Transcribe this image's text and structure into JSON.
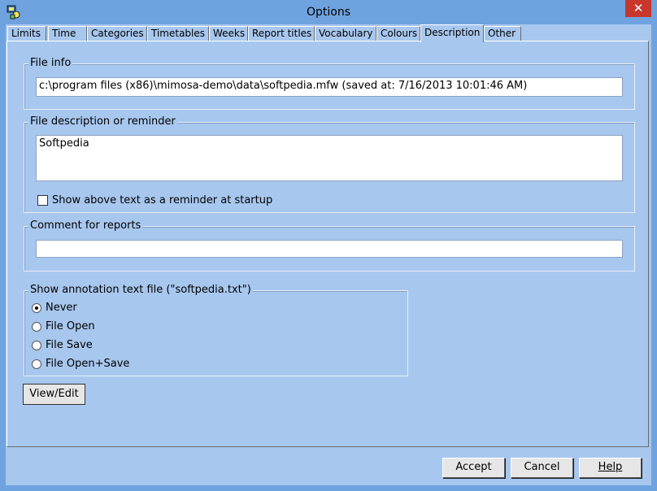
{
  "window": {
    "title": "Options",
    "close_glyph": "✕"
  },
  "tabs": [
    {
      "label": "Limits"
    },
    {
      "label": "Time"
    },
    {
      "label": "Categories"
    },
    {
      "label": "Timetables"
    },
    {
      "label": "Weeks"
    },
    {
      "label": "Report titles"
    },
    {
      "label": "Vocabulary"
    },
    {
      "label": "Colours"
    },
    {
      "label": "Description",
      "active": true
    },
    {
      "label": "Other"
    }
  ],
  "file_info": {
    "title": "File info",
    "value": "c:\\program files (x86)\\mimosa-demo\\data\\softpedia.mfw (saved at: 7/16/2013 10:01:46 AM)"
  },
  "description": {
    "title": "File description or reminder",
    "value": "Softpedia",
    "reminder_label": "Show above text as a reminder at startup",
    "reminder_checked": false
  },
  "comment": {
    "title": "Comment for reports",
    "value": ""
  },
  "annotation": {
    "title": "Show annotation text file (\"softpedia.txt\")",
    "options": [
      {
        "label": "Never",
        "checked": true
      },
      {
        "label": "File Open",
        "checked": false
      },
      {
        "label": "File Save",
        "checked": false
      },
      {
        "label": "File Open+Save",
        "checked": false
      }
    ]
  },
  "buttons": {
    "view_edit": "View/Edit",
    "accept": "Accept",
    "cancel": "Cancel",
    "help": "Help"
  },
  "icons": {
    "app": "app-icon",
    "close": "close-icon"
  }
}
